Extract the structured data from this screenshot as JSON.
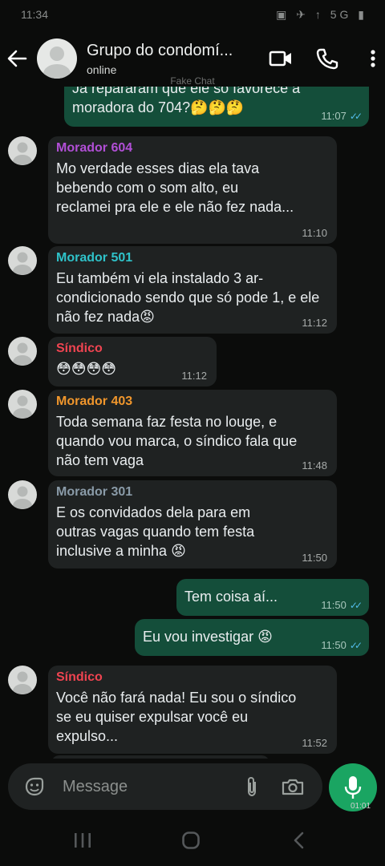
{
  "status_bar": {
    "time": "11:34",
    "icons": "▣ ✈ ↑ 5G ▮"
  },
  "header": {
    "title": "Grupo do condomí...",
    "subtitle": "online"
  },
  "watermark": "Fake Chat",
  "messages": [
    {
      "direction": "out",
      "text": "Já repararam que ele só favorece a moradora do 704?🤔🤔🤔",
      "time": "11:07",
      "ticks": "✓✓"
    },
    {
      "direction": "in",
      "sender": "Morador 604",
      "sender_color": "#b14fd6",
      "text": "Mo verdade esses dias ela tava bebendo com o som alto, eu reclamei pra ele e ele não fez nada...",
      "time": "11:10"
    },
    {
      "direction": "in",
      "sender": "Morador 501",
      "sender_color": "#2fc2c9",
      "text": "Eu também vi ela instalado 3 ar-condicionado sendo que só pode 1, e ele não fez nada😡",
      "time": "11:12"
    },
    {
      "direction": "in",
      "sender": "Síndico",
      "sender_color": "#ef4451",
      "text": "😳😳😳😳",
      "time": "11:12"
    },
    {
      "direction": "in",
      "sender": "Morador 403",
      "sender_color": "#f0962c",
      "text": "Toda semana faz festa no louge, e quando vou marca, o síndico fala que não tem vaga",
      "time": "11:48"
    },
    {
      "direction": "in",
      "sender": "Morador 301",
      "sender_color": "#8a9ba8",
      "text": "E os convidados dela para em outras vagas quando tem festa inclusive a minha 😡",
      "time": "11:50"
    },
    {
      "direction": "out",
      "text": "Tem coisa aí...",
      "time": "11:50",
      "ticks": "✓✓"
    },
    {
      "direction": "out",
      "text": "Eu vou investigar 😡",
      "time": "11:50",
      "ticks": "✓✓"
    },
    {
      "direction": "in",
      "sender": "Síndico",
      "sender_color": "#ef4451",
      "text": "Você não fará nada! Eu sou o síndico se eu quiser expulsar você eu expulso...",
      "time": "11:52"
    }
  ],
  "input": {
    "placeholder": "Message"
  },
  "recording_time": "01:01",
  "icons": {
    "back": "arrow-left",
    "video": "video-camera",
    "call": "phone",
    "menu": "more-vertical",
    "emoji": "sticker",
    "attach": "paperclip",
    "camera": "camera",
    "mic": "microphone"
  }
}
